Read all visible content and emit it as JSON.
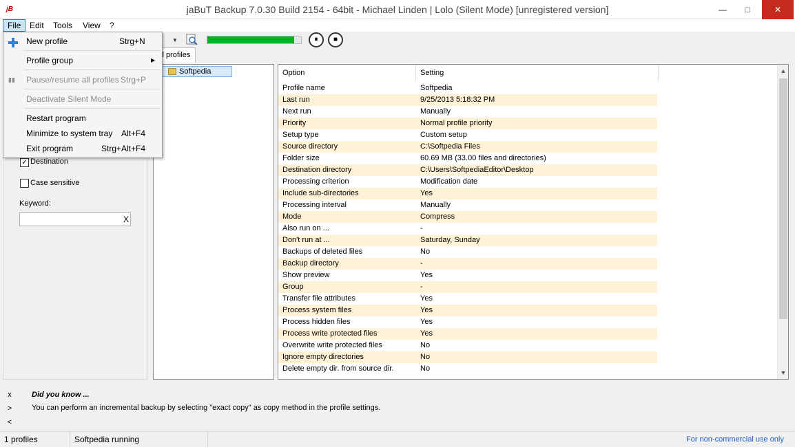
{
  "window": {
    "title": "jaBuT Backup 7.0.30 Build 2154 - 64bit - Michael Linden     |     Lolo (Silent Mode) [unregistered version]",
    "app_icon": "jB",
    "min_glyph": "—",
    "max_glyph": "□",
    "close_glyph": "✕"
  },
  "menubar": {
    "file": "File",
    "edit": "Edit",
    "tools": "Tools",
    "view": "View",
    "help": "?"
  },
  "toolbar": {
    "progress": 0.93,
    "progress_color": "#06b025",
    "pause_glyph": "⏸",
    "stop_glyph": "■"
  },
  "file_menu": {
    "items": [
      {
        "label": "New profile",
        "shortcut": "Strg+N",
        "icon": "plus-icon"
      },
      {
        "label": "Profile group",
        "submenu": "▶"
      },
      {
        "label": "Pause/resume all profiles",
        "shortcut": "Strg+P",
        "icon": "pause-icon",
        "icon_glyph": "▮▮"
      },
      {
        "label": "Deactivate Silent Mode"
      },
      {
        "label": "Restart program"
      },
      {
        "label": "Minimize to system tray",
        "shortcut": "Alt+F4"
      },
      {
        "label": "Exit program",
        "shortcut": "Strg+Alt+F4"
      }
    ]
  },
  "tab": {
    "label": "ll profiles"
  },
  "filter": {
    "destination_label": "Destination",
    "destination_checked": "✓",
    "case_sensitive_label": "Case sensitive",
    "keyword_label": "Keyword:",
    "clear_glyph": "X"
  },
  "tree": {
    "node_label": "Softpedia"
  },
  "grid": {
    "headers": {
      "option": "Option",
      "setting": "Setting"
    },
    "rows": [
      {
        "option": "Profile name",
        "setting": "Softpedia"
      },
      {
        "option": "Last run",
        "setting": "9/25/2013 5:18:32 PM"
      },
      {
        "option": "Next run",
        "setting": "Manually"
      },
      {
        "option": "Priority",
        "setting": "Normal profile priority"
      },
      {
        "option": "Setup type",
        "setting": "Custom setup"
      },
      {
        "option": "Source directory",
        "setting": "C:\\Softpedia Files"
      },
      {
        "option": "Folder size",
        "setting": "60.69 MB (33.00 files and directories)"
      },
      {
        "option": "Destination directory",
        "setting": "C:\\Users\\SoftpediaEditor\\Desktop"
      },
      {
        "option": "Processing criterion",
        "setting": "Modification date"
      },
      {
        "option": "Include sub-directories",
        "setting": "Yes"
      },
      {
        "option": "Processing interval",
        "setting": "Manually"
      },
      {
        "option": "Mode",
        "setting": "Compress"
      },
      {
        "option": "Also run on ...",
        "setting": "-"
      },
      {
        "option": "Don't run at ...",
        "setting": "Saturday, Sunday"
      },
      {
        "option": "Backups of deleted files",
        "setting": "No"
      },
      {
        "option": "Backup directory",
        "setting": "-"
      },
      {
        "option": "Show preview",
        "setting": "Yes"
      },
      {
        "option": "Group",
        "setting": "-"
      },
      {
        "option": "Transfer file attributes",
        "setting": "Yes"
      },
      {
        "option": "Process system files",
        "setting": "Yes"
      },
      {
        "option": "Process hidden files",
        "setting": "Yes"
      },
      {
        "option": "Process write protected files",
        "setting": "Yes"
      },
      {
        "option": "Overwrite write protected files",
        "setting": "No"
      },
      {
        "option": "Ignore empty directories",
        "setting": "No"
      },
      {
        "option": "Delete empty dir. from source dir.",
        "setting": "No"
      }
    ]
  },
  "tips": {
    "close_glyph": "x",
    "next_glyph": ">",
    "prev_glyph": "<",
    "title": "Did you know ...",
    "text": "You can perform an incremental backup by selecting \"exact copy\" as copy method in the profile settings."
  },
  "statusbar": {
    "profiles": "1 profiles",
    "status": "Softpedia running",
    "license": "For non-commercial use only"
  }
}
